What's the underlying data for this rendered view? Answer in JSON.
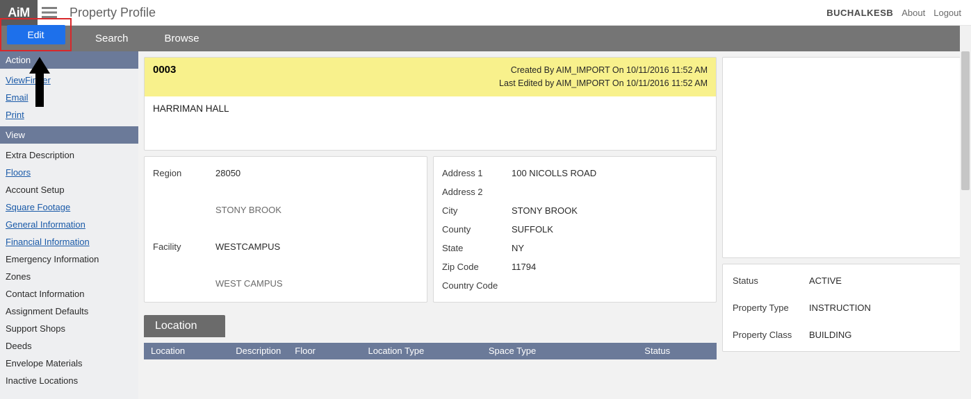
{
  "brand": {
    "logo_text": "AiM"
  },
  "header": {
    "page_title": "Property Profile",
    "username": "BUCHALKESB",
    "about": "About",
    "logout": "Logout"
  },
  "toolbar": {
    "edit": "Edit",
    "search": "Search",
    "browse": "Browse"
  },
  "sidebar": {
    "action_label": "Action",
    "view_label": "View",
    "actions": [
      {
        "label": "ViewFinder",
        "link": true
      },
      {
        "label": "Email",
        "link": true
      },
      {
        "label": "Print",
        "link": true
      }
    ],
    "views": [
      {
        "label": "Extra Description",
        "link": false
      },
      {
        "label": "Floors",
        "link": true
      },
      {
        "label": "Account Setup",
        "link": false
      },
      {
        "label": "Square Footage",
        "link": true
      },
      {
        "label": "General Information",
        "link": true
      },
      {
        "label": "Financial Information",
        "link": true
      },
      {
        "label": "Emergency Information",
        "link": false
      },
      {
        "label": "Zones",
        "link": false
      },
      {
        "label": "Contact Information",
        "link": false
      },
      {
        "label": "Assignment Defaults",
        "link": false
      },
      {
        "label": "Support Shops",
        "link": false
      },
      {
        "label": "Deeds",
        "link": false
      },
      {
        "label": "Envelope Materials",
        "link": false
      },
      {
        "label": "Inactive Locations",
        "link": false
      }
    ]
  },
  "record": {
    "id": "0003",
    "name": "HARRIMAN HALL",
    "created_by_line": "Created By AIM_IMPORT On 10/11/2016 11:52 AM",
    "edited_by_line": "Last Edited by AIM_IMPORT On 10/11/2016 11:52 AM"
  },
  "region": {
    "label_region": "Region",
    "region_code": "28050",
    "region_name": "STONY BROOK",
    "label_facility": "Facility",
    "facility_code": "WESTCAMPUS",
    "facility_name": "WEST CAMPUS"
  },
  "address": {
    "label_addr1": "Address 1",
    "addr1": "100 NICOLLS ROAD",
    "label_addr2": "Address 2",
    "addr2": "",
    "label_city": "City",
    "city": "STONY BROOK",
    "label_county": "County",
    "county": "SUFFOLK",
    "label_state": "State",
    "state": "NY",
    "label_zip": "Zip Code",
    "zip": "11794",
    "label_country": "Country Code",
    "country": ""
  },
  "status": {
    "label_status": "Status",
    "status": "ACTIVE",
    "label_ptype": "Property Type",
    "ptype": "INSTRUCTION",
    "label_pclass": "Property Class",
    "pclass": "BUILDING"
  },
  "location": {
    "tab": "Location",
    "cols": {
      "loc": "Location",
      "desc": "Description",
      "floor": "Floor",
      "ltype": "Location Type",
      "stype": "Space Type",
      "status": "Status"
    }
  }
}
